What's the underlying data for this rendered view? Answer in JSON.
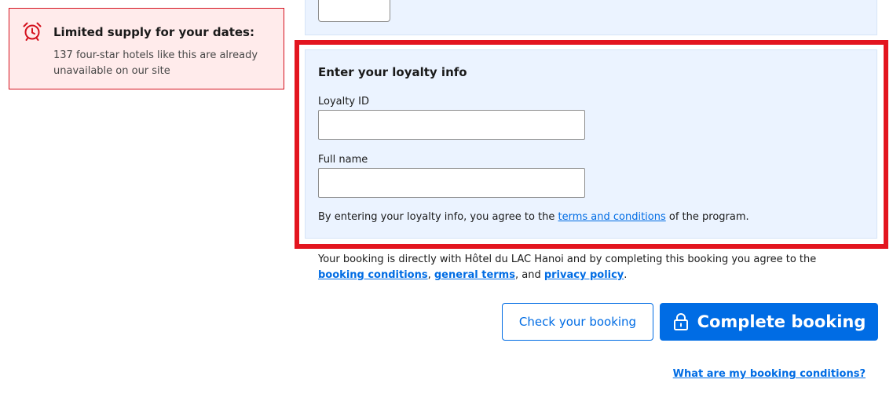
{
  "alert": {
    "title": "Limited supply for your dates:",
    "body": "137 four-star hotels like this are already unavailable on our site",
    "icon": "alarm-clock-icon",
    "color": "#d4111e"
  },
  "loyalty": {
    "heading": "Enter your loyalty info",
    "loyalty_id_label": "Loyalty ID",
    "loyalty_id_value": "",
    "full_name_label": "Full name",
    "full_name_value": "",
    "note_prefix": "By entering your loyalty info, you agree to the ",
    "note_link": "terms and conditions",
    "note_suffix": " of the program."
  },
  "agreement": {
    "prefix": "Your booking is directly with Hôtel du LAC Hanoi and by completing this booking you agree to the ",
    "booking_conditions": "booking conditions",
    "sep1": ", ",
    "general_terms": "general terms",
    "sep2": ", and ",
    "privacy_policy": "privacy policy",
    "suffix": "."
  },
  "buttons": {
    "check_label": "Check your booking",
    "complete_label": "Complete booking"
  },
  "footer": {
    "conditions_link": "What are my booking conditions?"
  },
  "colors": {
    "accent": "#006ce4",
    "highlight": "#e3151f",
    "panel_bg": "#ebf3ff"
  }
}
